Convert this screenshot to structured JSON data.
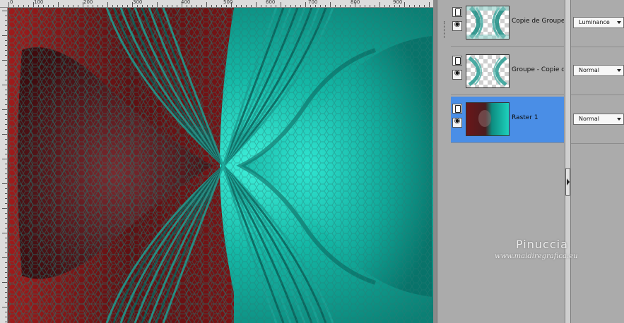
{
  "ruler": {
    "top_labels": [
      "0",
      "100",
      "200",
      "300",
      "400",
      "500",
      "600",
      "700",
      "800",
      "900"
    ]
  },
  "layers": [
    {
      "name": "Copie de Groupe -",
      "blend_mode": "Luminance",
      "selected": false,
      "group_child": true
    },
    {
      "name": "Groupe - Copie de",
      "blend_mode": "Normal",
      "selected": false,
      "group_child": false
    },
    {
      "name": "Raster 1",
      "blend_mode": "Normal",
      "selected": true,
      "group_child": false
    }
  ],
  "icons": {
    "lock": "layer-lock-icon",
    "visibility": "eye-icon",
    "dropdown": "chevron-down-icon",
    "splitter": "panel-collapse-arrow-icon"
  },
  "watermark": {
    "name": "Pinuccia",
    "url": "www.maidiregrafica.eu"
  },
  "colors": {
    "selection": "#4a8ee6",
    "teal": "#12b3a1",
    "dark_red": "#7e1416",
    "panel_bg": "#ababab"
  }
}
